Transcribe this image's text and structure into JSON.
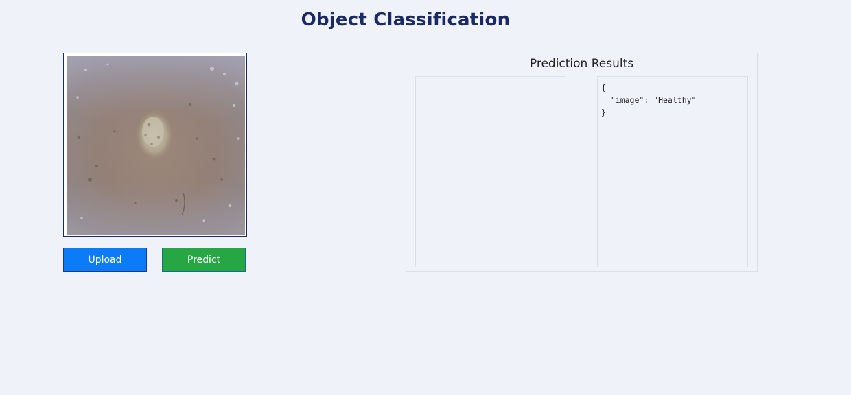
{
  "page": {
    "title": "Object Classification"
  },
  "upload_panel": {
    "preview_image": "uploaded leaf image (brownish surface with pale lesion)",
    "upload_label": "Upload",
    "predict_label": "Predict"
  },
  "results": {
    "title": "Prediction Results",
    "json_output": "{\n  \"image\": \"Healthy\"\n}"
  },
  "colors": {
    "title": "#1a2a66",
    "upload_button": "#0b7bf7",
    "predict_button": "#26a744",
    "background": "#eff2f8"
  }
}
